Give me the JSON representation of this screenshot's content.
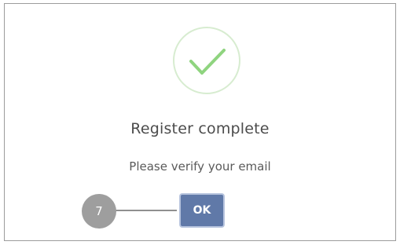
{
  "dialog": {
    "title": "Register complete",
    "message": "Please verify your email",
    "ok_label": "OK",
    "success_icon": "checkmark-icon"
  },
  "annotation": {
    "step_number": "7"
  },
  "colors": {
    "success_green": "#8fd47f",
    "button_blue": "#6079a8",
    "callout_gray": "#9e9e9e"
  }
}
